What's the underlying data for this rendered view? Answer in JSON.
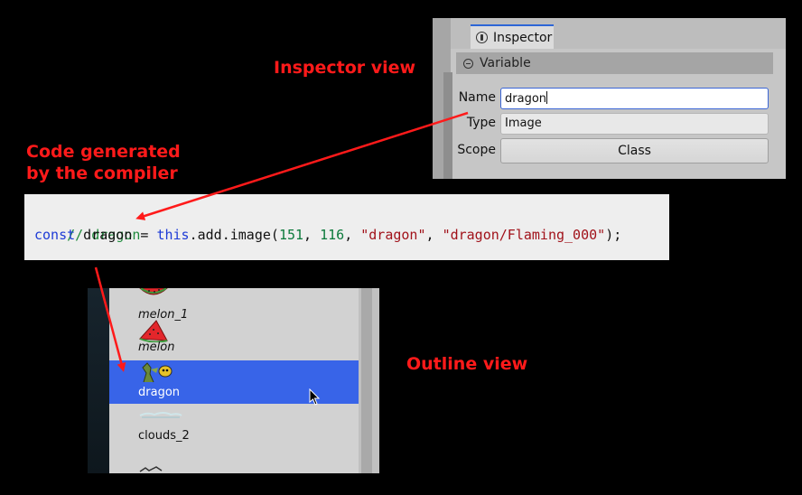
{
  "inspector": {
    "tab_label": "Inspector",
    "section_title": "Variable",
    "name_label": "Name",
    "name_value": "dragon",
    "type_label": "Type",
    "type_value": "Image",
    "scope_label": "Scope",
    "scope_value": "Class"
  },
  "callouts": {
    "inspector": "Inspector view",
    "code_line1": "Code generated",
    "code_line2": "by the compiler",
    "outline": "Outline view"
  },
  "code": {
    "comment": "// dragon",
    "kw": "const",
    "decl": " dragon = ",
    "this": "this",
    "call": ".add.image(",
    "n1": "151",
    "sep1": ", ",
    "n2": "116",
    "sep2": ", ",
    "s1": "\"dragon\"",
    "sep3": ", ",
    "s2": "\"dragon/Flaming_000\"",
    "end": ");"
  },
  "outline": {
    "items": [
      {
        "label": "melon_1",
        "icon": "melon-icon"
      },
      {
        "label": "melon",
        "icon": "melon-icon"
      },
      {
        "label": "dragon",
        "icon": "dragon-icon"
      },
      {
        "label": "clouds_2",
        "icon": "clouds-icon"
      }
    ]
  },
  "colors": {
    "callout": "#ff1a1a",
    "selection": "#3864e8",
    "tab_accent": "#2d66d6"
  }
}
